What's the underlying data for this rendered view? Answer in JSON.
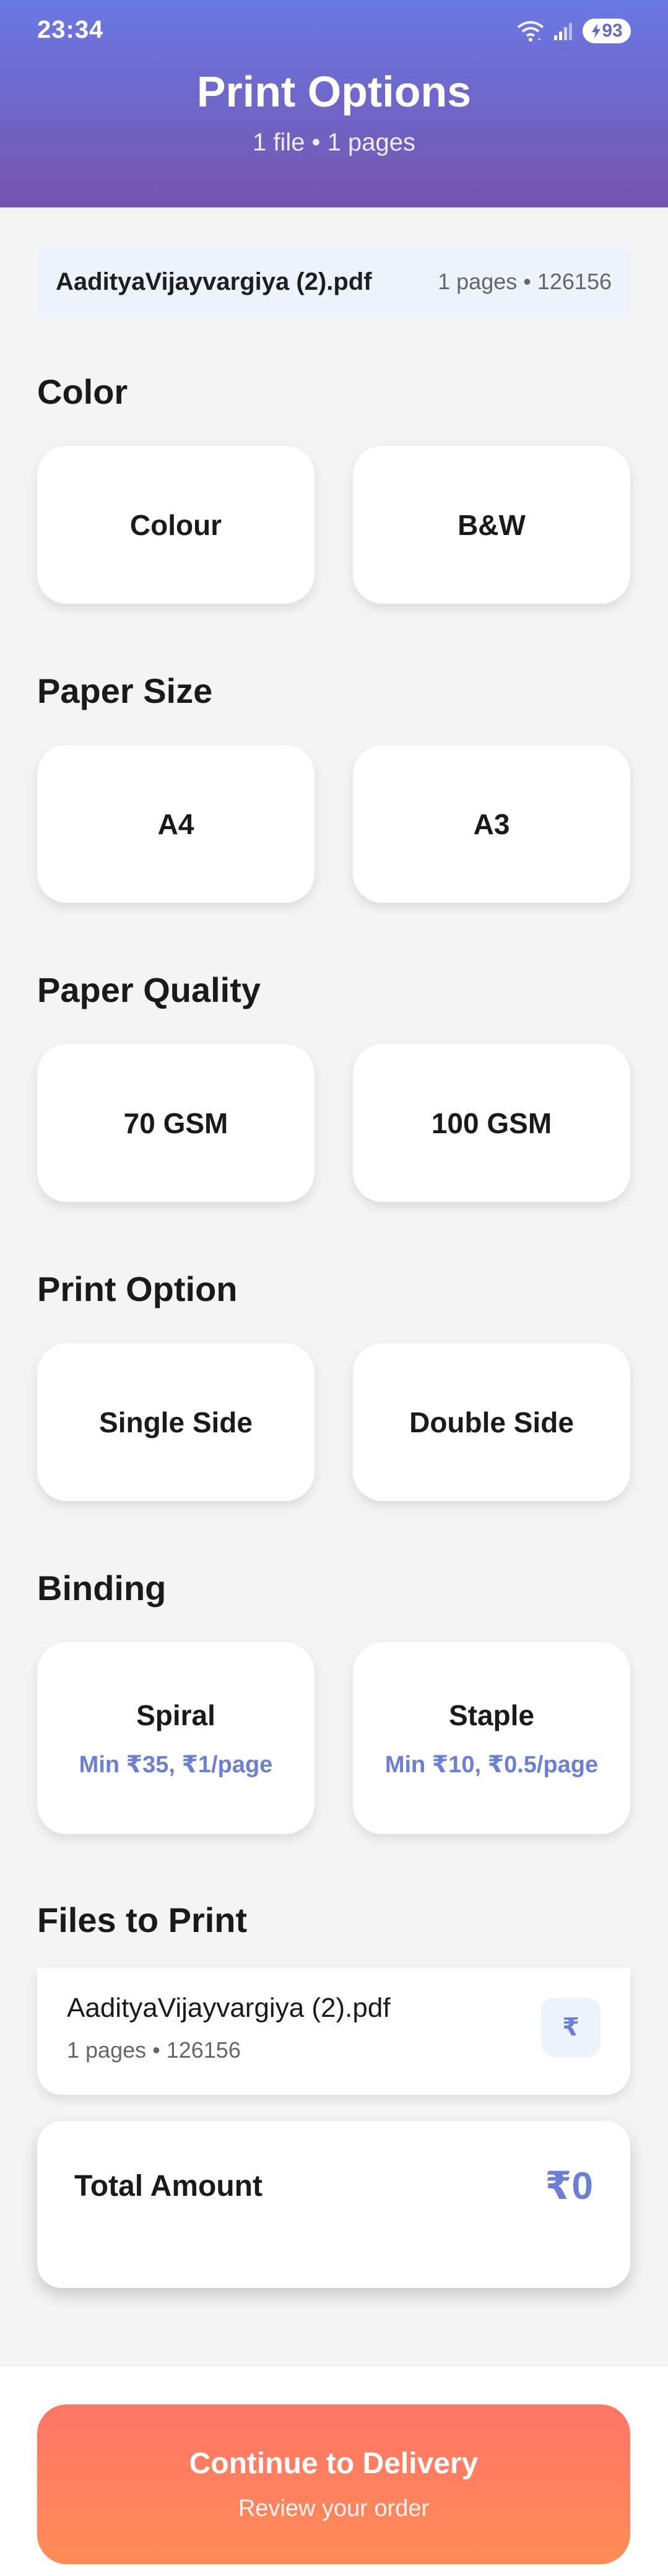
{
  "status_bar": {
    "time": "23:34",
    "battery": "93",
    "icons": [
      "wifi-icon",
      "signal-icon",
      "battery-charging-icon"
    ]
  },
  "header": {
    "title": "Print Options",
    "subtitle": "1 file • 1 pages"
  },
  "file_summary": {
    "name": "AadityaVijayvargiya (2).pdf",
    "meta": "1 pages • 126156"
  },
  "sections": {
    "color": {
      "title": "Color",
      "options": [
        "Colour",
        "B&W"
      ]
    },
    "paper_size": {
      "title": "Paper Size",
      "options": [
        "A4",
        "A3"
      ]
    },
    "paper_quality": {
      "title": "Paper Quality",
      "options": [
        "70 GSM",
        "100 GSM"
      ]
    },
    "print_option": {
      "title": "Print Option",
      "options": [
        "Single Side",
        "Double Side"
      ]
    },
    "binding": {
      "title": "Binding",
      "options": [
        {
          "label": "Spiral",
          "price": "Min ₹35, ₹1/page"
        },
        {
          "label": "Staple",
          "price": "Min ₹10, ₹0.5/page"
        }
      ]
    }
  },
  "files_to_print": {
    "title": "Files to Print",
    "items": [
      {
        "name": "AadityaVijayvargiya (2).pdf",
        "meta": "1 pages • 126156",
        "price_icon": "₹"
      }
    ]
  },
  "total": {
    "label": "Total Amount",
    "amount": "₹0"
  },
  "cta": {
    "label": "Continue to Delivery",
    "sublabel": "Review your order"
  },
  "colors": {
    "header_gradient_start": "#6a79e4",
    "header_gradient_end": "#7554ad",
    "accent": "#6b7fd7",
    "cta_start": "#ff7568",
    "cta_end": "#ff8c55",
    "background": "#f4f4f4"
  }
}
